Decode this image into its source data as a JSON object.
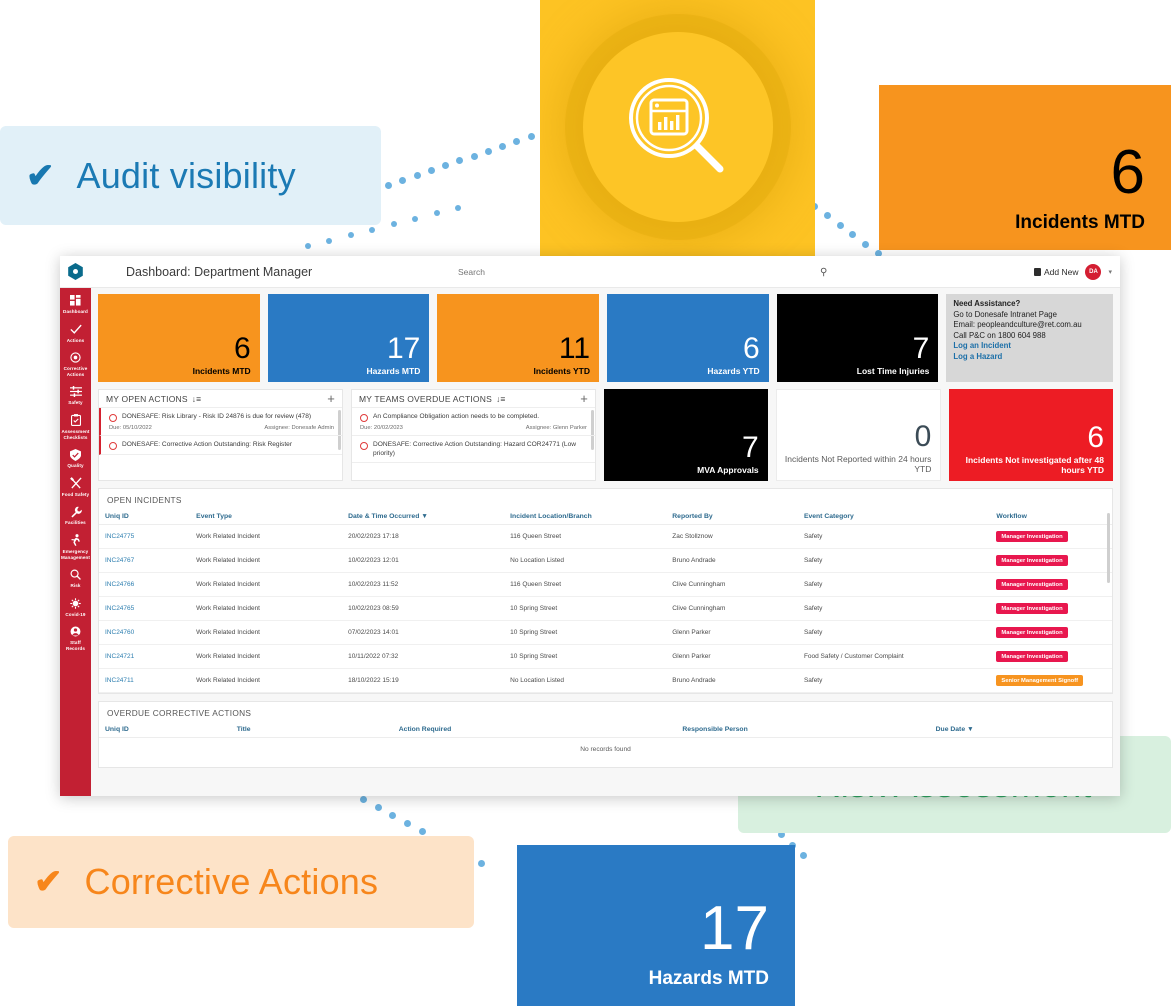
{
  "callouts": [
    {
      "id": "audit",
      "label": "Audit visibility",
      "icon": "check-icon",
      "color": "#1b7ab4"
    },
    {
      "id": "risk",
      "label": "Risk Assessment",
      "icon": "check-icon",
      "color": "#2fa360"
    },
    {
      "id": "corrective",
      "label": "Corrective Actions",
      "icon": "check-icon",
      "color": "#f7861b"
    }
  ],
  "floating_cards": [
    {
      "id": "incidents-mtd",
      "value": "6",
      "label": "Incidents MTD",
      "color": "#f7941e"
    },
    {
      "id": "hazards-mtd",
      "value": "17",
      "label": "Hazards MTD",
      "color": "#2a7ac4"
    }
  ],
  "feature_tile": {
    "icon": "magnifier-dashboard-icon",
    "color": "#fdc323"
  },
  "app": {
    "topbar": {
      "logo": "donesafe-hexagon-logo",
      "title": "Dashboard: Department Manager",
      "search_placeholder": "Search",
      "search_value": "",
      "search_icon": "search-icon",
      "add_new_label": "Add New",
      "avatar_initials": "DA",
      "caret_icon": "chevron-down-icon"
    },
    "sidebar": [
      {
        "label": "Dashboard",
        "icon": "grid-icon"
      },
      {
        "label": "Actions",
        "icon": "check-icon"
      },
      {
        "label": "Corrective Actions",
        "icon": "target-icon"
      },
      {
        "label": "Safety",
        "icon": "sliders-icon"
      },
      {
        "label": "Assessment Checklists",
        "icon": "clipboard-check-icon"
      },
      {
        "label": "Quality",
        "icon": "badge-icon"
      },
      {
        "label": "Food Safety",
        "icon": "cutlery-icon"
      },
      {
        "label": "Facilities",
        "icon": "wrench-icon"
      },
      {
        "label": "Emergency Management",
        "icon": "running-person-icon"
      },
      {
        "label": "Risk",
        "icon": "search-icon"
      },
      {
        "label": "Covid-19",
        "icon": "virus-icon"
      },
      {
        "label": "Staff Records",
        "icon": "user-icon"
      }
    ],
    "kpis": [
      {
        "value": "6",
        "label": "Incidents MTD",
        "style": "orange"
      },
      {
        "value": "17",
        "label": "Hazards MTD",
        "style": "blue"
      },
      {
        "value": "11",
        "label": "Incidents YTD",
        "style": "orange"
      },
      {
        "value": "6",
        "label": "Hazards YTD",
        "style": "blue"
      },
      {
        "value": "7",
        "label": "Lost Time Injuries",
        "style": "black"
      }
    ],
    "assistance": {
      "heading": "Need Assistance?",
      "line1": "Go to Donesafe Intranet Page",
      "line2": "Email: peopleandculture@ret.com.au",
      "line3": "Call P&C on 1800 604 988",
      "link1": "Log an Incident",
      "link2": "Log a Hazard"
    },
    "my_open_actions": {
      "title": "MY OPEN ACTIONS",
      "sort_icon": "sort-icon",
      "add_icon": "plus-icon",
      "items": [
        {
          "text": "DONESAFE: Risk Library - Risk ID 24876 is due for review (478)",
          "due": "Due: 05/10/2022",
          "assignee": "Assignee: Donesafe Admin"
        },
        {
          "text": "DONESAFE: Corrective Action Outstanding: Risk Register",
          "due": "",
          "assignee": ""
        }
      ]
    },
    "my_teams_overdue_actions": {
      "title": "MY TEAMS OVERDUE ACTIONS",
      "sort_icon": "sort-icon",
      "add_icon": "plus-icon",
      "items": [
        {
          "text": "An Compliance Obligation action needs to be completed.",
          "due": "Due: 20/02/2023",
          "assignee": "Assignee: Glenn Parker"
        },
        {
          "text": "DONESAFE: Corrective Action Outstanding: Hazard COR24771 (Low priority)",
          "due": "",
          "assignee": ""
        }
      ]
    },
    "mid_kpis": [
      {
        "value": "7",
        "label": "MVA Approvals",
        "style": "black"
      },
      {
        "value": "0",
        "label": "Incidents Not Reported within 24 hours YTD",
        "style": "white"
      },
      {
        "value": "6",
        "label": "Incidents Not investigated after 48 hours YTD",
        "style": "red"
      }
    ],
    "open_incidents": {
      "title": "OPEN INCIDENTS",
      "columns": [
        "Uniq ID",
        "Event Type",
        "Date & Time Occurred ▼",
        "Incident Location/Branch",
        "Reported By",
        "Event Category",
        "Workflow"
      ],
      "rows": [
        {
          "id": "INC24775",
          "type": "Work Related Incident",
          "datetime": "20/02/2023 17:18",
          "location": "116 Queen Street",
          "reporter": "Zac Stollznow",
          "category": "Safety",
          "workflow": "Manager Investigation",
          "workflow_style": "pink"
        },
        {
          "id": "INC24767",
          "type": "Work Related Incident",
          "datetime": "10/02/2023 12:01",
          "location": "No Location Listed",
          "reporter": "Bruno Andrade",
          "category": "Safety",
          "workflow": "Manager Investigation",
          "workflow_style": "pink"
        },
        {
          "id": "INC24766",
          "type": "Work Related Incident",
          "datetime": "10/02/2023 11:52",
          "location": "116 Queen Street",
          "reporter": "Clive Cunningham",
          "category": "Safety",
          "workflow": "Manager Investigation",
          "workflow_style": "pink"
        },
        {
          "id": "INC24765",
          "type": "Work Related Incident",
          "datetime": "10/02/2023 08:59",
          "location": "10 Spring Street",
          "reporter": "Clive Cunningham",
          "category": "Safety",
          "workflow": "Manager Investigation",
          "workflow_style": "pink"
        },
        {
          "id": "INC24760",
          "type": "Work Related Incident",
          "datetime": "07/02/2023 14:01",
          "location": "10 Spring Street",
          "reporter": "Glenn Parker",
          "category": "Safety",
          "workflow": "Manager Investigation",
          "workflow_style": "pink"
        },
        {
          "id": "INC24721",
          "type": "Work Related Incident",
          "datetime": "10/11/2022 07:32",
          "location": "10 Spring Street",
          "reporter": "Glenn Parker",
          "category": "Food Safety / Customer Complaint",
          "workflow": "Manager Investigation",
          "workflow_style": "pink"
        },
        {
          "id": "INC24711",
          "type": "Work Related Incident",
          "datetime": "18/10/2022 15:19",
          "location": "No Location Listed",
          "reporter": "Bruno Andrade",
          "category": "Safety",
          "workflow": "Senior Management Signoff",
          "workflow_style": "orange"
        }
      ]
    },
    "overdue_corrective_actions": {
      "title": "OVERDUE CORRECTIVE ACTIONS",
      "columns": [
        "Uniq ID",
        "Title",
        "Action Required",
        "Responsible Person",
        "Due Date ▼"
      ],
      "empty_message": "No records found"
    }
  }
}
